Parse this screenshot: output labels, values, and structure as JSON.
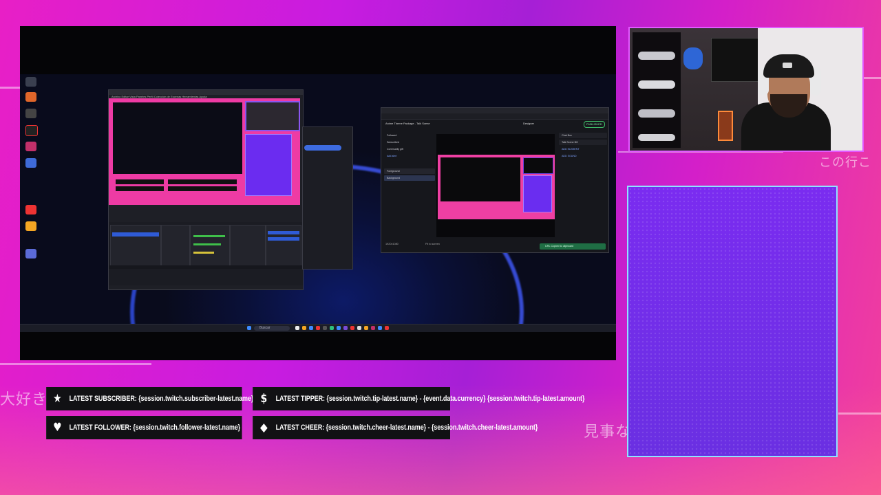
{
  "overlay": {
    "jp_left": "大好き",
    "jp_right_top": "この行こ",
    "jp_right_bottom": "見事な"
  },
  "alerts": {
    "subscriber": {
      "icon": "star-icon",
      "glyph": "★",
      "text": "LATEST SUBSCRIBER: {session.twitch.subscriber-latest.name}"
    },
    "follower": {
      "icon": "heart-icon",
      "glyph": "♥",
      "text": "LATEST FOLLOWER: {session.twitch.follower-latest.name}"
    },
    "tipper": {
      "icon": "dollar-icon",
      "glyph": "$",
      "text": "LATEST TIPPER: {session.twitch.tip-latest.name} - {event.data.currency} {session.twitch.tip-latest.amount}"
    },
    "cheer": {
      "icon": "diamond-icon",
      "glyph": "◆",
      "text": "LATEST CHEER: {session.twitch.cheer-latest.name} - {session.twitch.cheer-latest.amount}"
    }
  },
  "screen_capture": {
    "obs_window": {
      "menu": "Archivo  Editar  Vista  Paneles  Perfil  Colección de Escenas  Herramientas  Ayuda"
    },
    "designer_window": {
      "breadcrumb": "Anime Theme Package - Talk Scene",
      "mode": "Designer",
      "publish_label": "PUBLISHED",
      "layers": [
        "Followed",
        "Subscribed",
        "Community gift",
        "Add alert"
      ],
      "scenes": [
        "Foreground",
        "Background"
      ],
      "right_items": [
        "Chat Box",
        "Talk Scene BG",
        "ADD ELEMENT",
        "ADD SOUND"
      ],
      "size_label": "1920x1080",
      "fit_label": "Fit to screen",
      "toast": "URL Copied to clipboard"
    },
    "taskbar_search": "Buscar"
  },
  "colors": {
    "accent_pink": "#e81fc6",
    "panel_purple": "#7a2cf0",
    "panel_border": "#8fe3ff",
    "alert_bg": "#111114"
  }
}
